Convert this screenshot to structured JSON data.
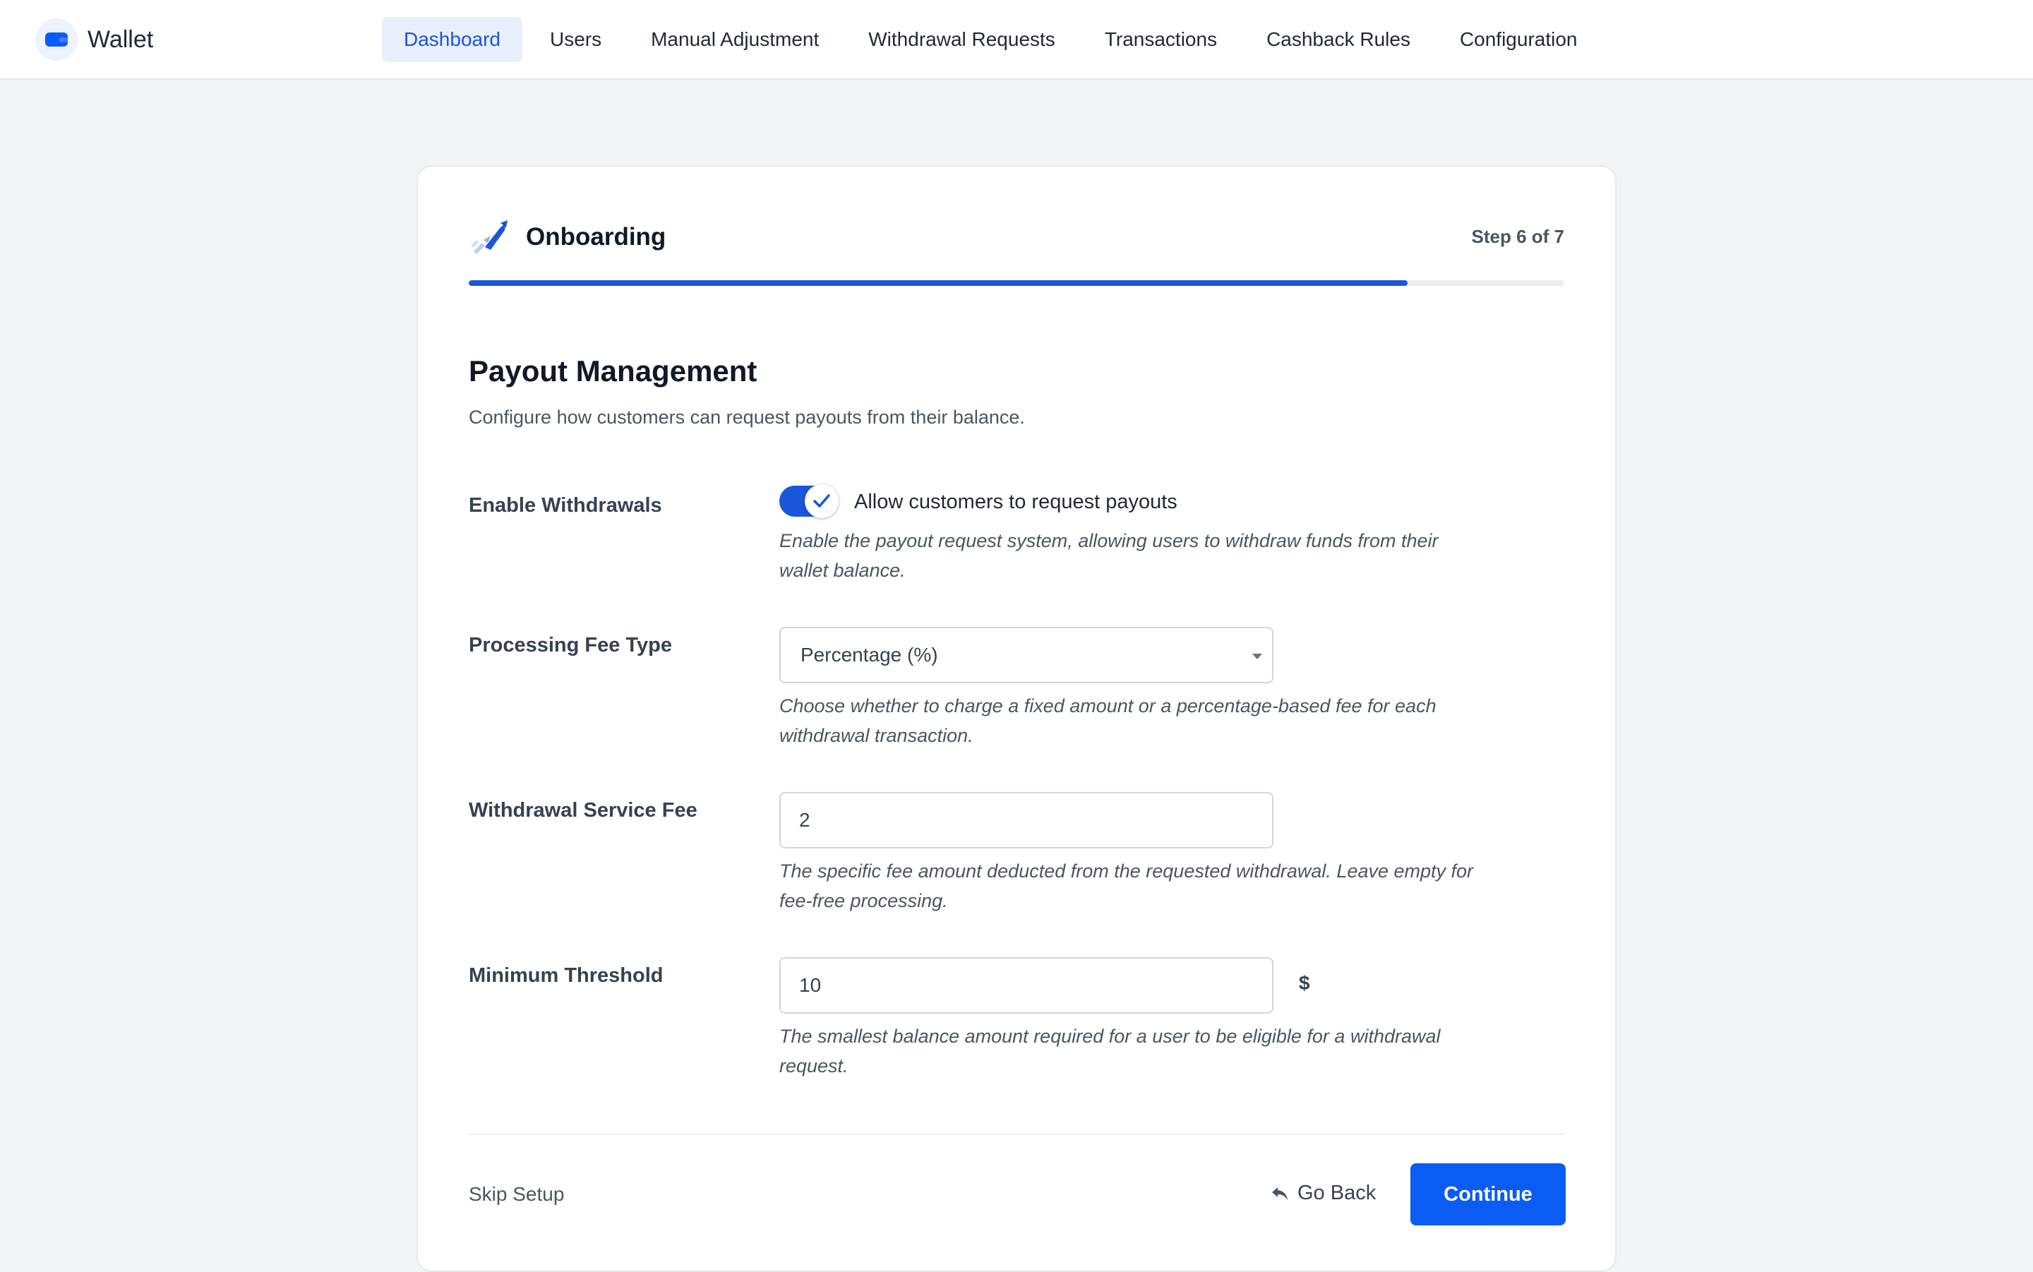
{
  "app": {
    "name": "Wallet",
    "logo_icon": "wallet-icon"
  },
  "nav": {
    "items": [
      {
        "label": "Dashboard",
        "active": true
      },
      {
        "label": "Users",
        "active": false
      },
      {
        "label": "Manual Adjustment",
        "active": false
      },
      {
        "label": "Withdrawal Requests",
        "active": false
      },
      {
        "label": "Transactions",
        "active": false
      },
      {
        "label": "Cashback Rules",
        "active": false
      },
      {
        "label": "Configuration",
        "active": false
      }
    ]
  },
  "onboarding": {
    "title": "Onboarding",
    "icon": "rocket-icon",
    "step_text": "Step 6 of 7",
    "progress_fraction": 0.857
  },
  "section": {
    "title": "Payout Management",
    "description": "Configure how customers can request payouts from their balance."
  },
  "fields": {
    "enable_withdrawals": {
      "label": "Enable Withdrawals",
      "toggle_on": true,
      "toggle_label": "Allow customers to request payouts",
      "help_line1": "Enable the payout request system, allowing users to withdraw funds from their",
      "help_line2": "wallet balance."
    },
    "fee_type": {
      "label": "Processing Fee Type",
      "selected": "Percentage (%)",
      "help_line1": "Choose whether to charge a fixed amount or a percentage-based fee for each",
      "help_line2": "withdrawal transaction."
    },
    "service_fee": {
      "label": "Withdrawal Service Fee",
      "value": "2",
      "help_line1": "The specific fee amount deducted from the requested withdrawal. Leave empty for",
      "help_line2": "fee-free processing."
    },
    "min_threshold": {
      "label": "Minimum Threshold",
      "value": "10",
      "unit": "$",
      "help_line1": "The smallest balance amount required for a user to be eligible for a withdrawal",
      "help_line2": "request."
    }
  },
  "footer": {
    "skip_label": "Skip Setup",
    "back_label": "Go Back",
    "continue_label": "Continue"
  },
  "colors": {
    "accent": "#1a56db",
    "primary_button": "#0b5cf5",
    "nav_active_bg": "#e8eefb"
  }
}
